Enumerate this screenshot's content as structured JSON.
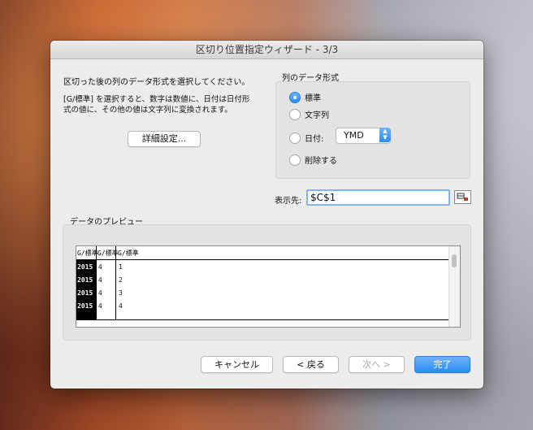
{
  "window": {
    "title": "区切り位置指定ウィザード - 3/3"
  },
  "description": "区切った後の列のデータ形式を選択してください。",
  "info_lines": [
    "[G/標準] を選択すると、数字は数値に、日付は日付形",
    "式の値に、その他の値は文字列に変換されます。"
  ],
  "advanced_button": "詳細設定...",
  "format_group": {
    "title": "列のデータ形式",
    "options": [
      "標準",
      "文字列",
      "日付:",
      "削除する"
    ],
    "selected": "標準",
    "date_format": "YMD"
  },
  "destination": {
    "label": "表示先:",
    "value": "$C$1"
  },
  "preview": {
    "title": "データのプレビュー",
    "headers": [
      "G/標準",
      "G/標準",
      "G/標準"
    ],
    "rows": [
      [
        "2015",
        "4",
        "1"
      ],
      [
        "2015",
        "4",
        "2"
      ],
      [
        "2015",
        "4",
        "3"
      ],
      [
        "2015",
        "4",
        "4"
      ]
    ]
  },
  "buttons": {
    "cancel": "キャンセル",
    "back": "< 戻る",
    "next": "次へ >",
    "finish": "完了"
  }
}
